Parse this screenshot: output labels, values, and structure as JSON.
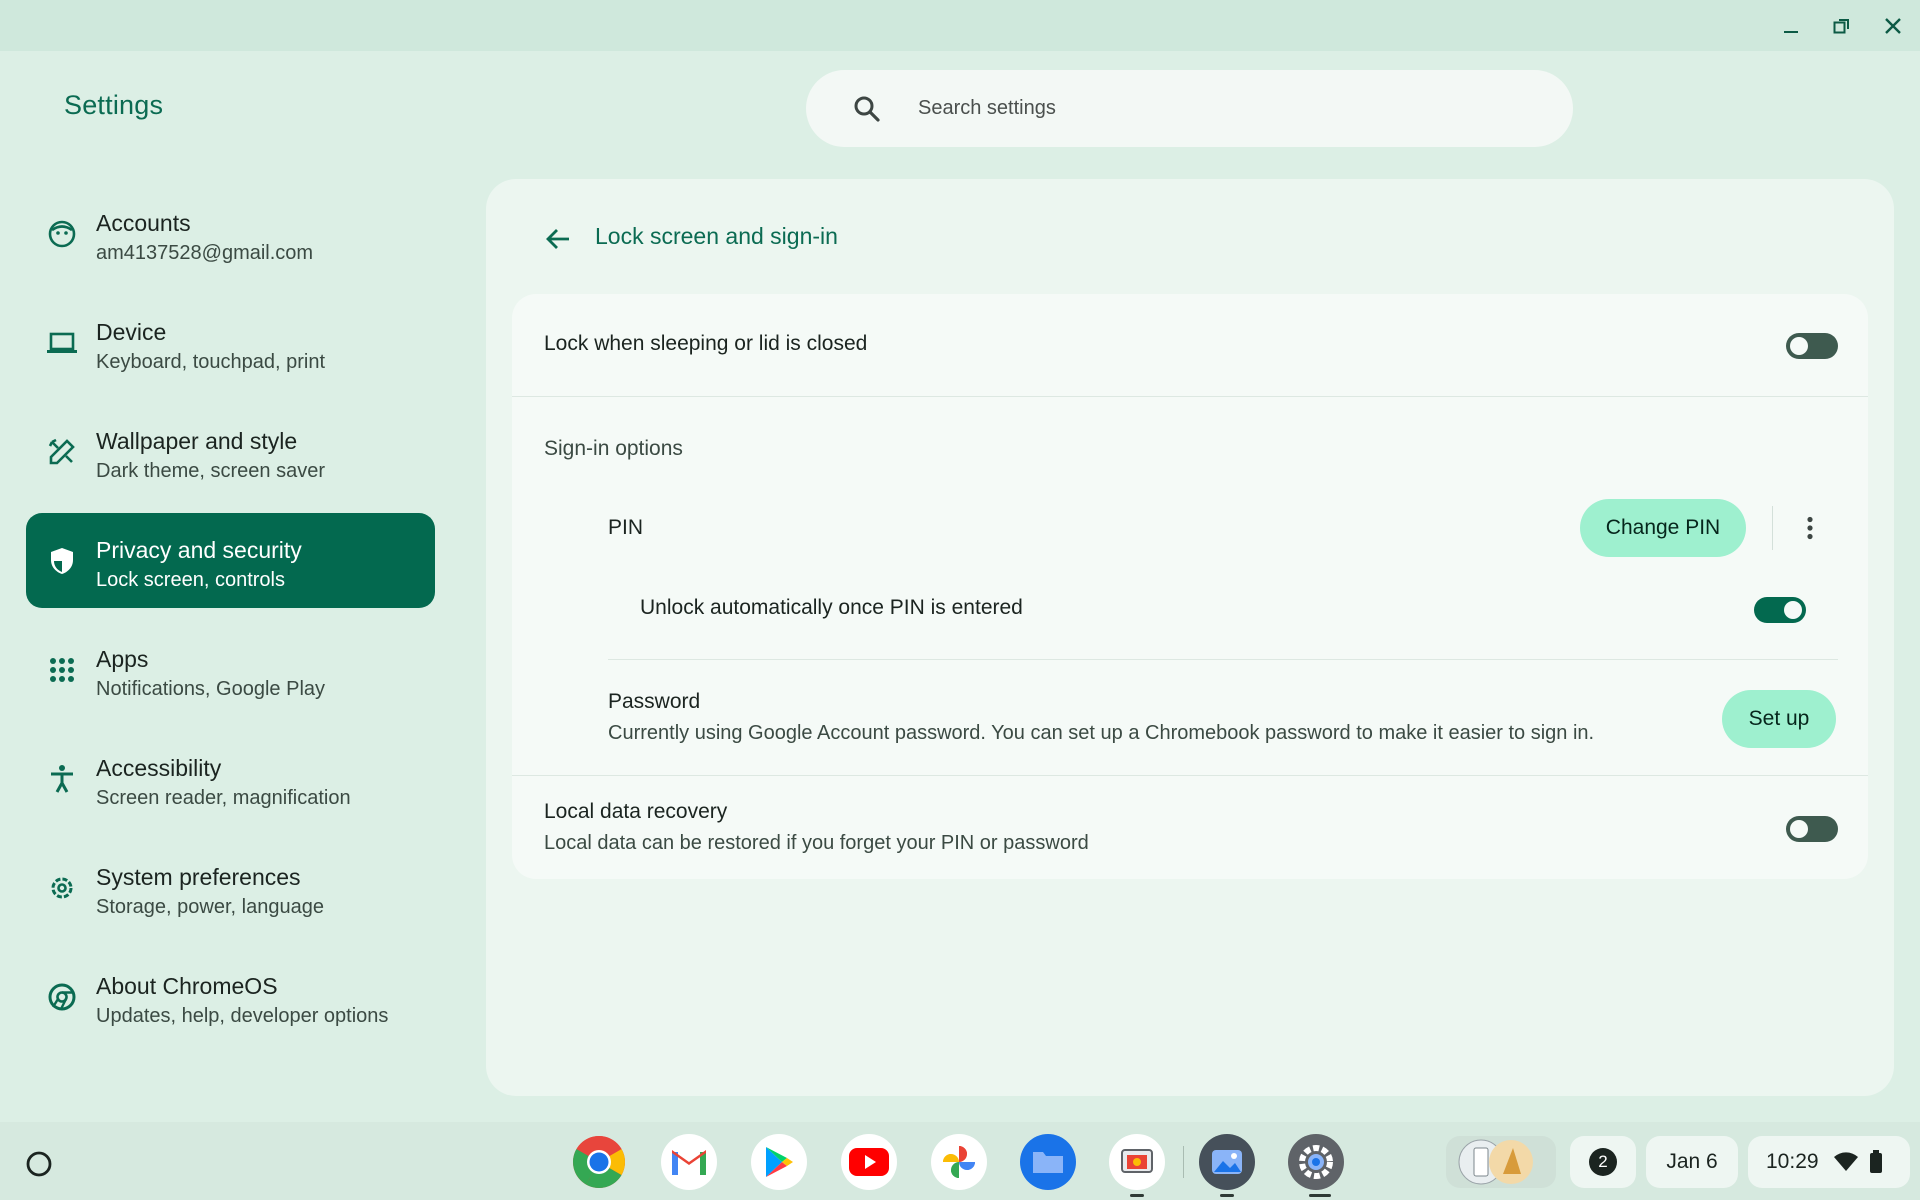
{
  "window": {
    "minimize_label": "Minimize",
    "maximize_label": "Restore",
    "close_label": "Close"
  },
  "app_title": "Settings",
  "search": {
    "placeholder": "Search settings"
  },
  "sidebar": {
    "items": [
      {
        "title": "Accounts",
        "subtitle": "am4137528@gmail.com",
        "icon": "account-face-icon"
      },
      {
        "title": "Device",
        "subtitle": "Keyboard, touchpad, print",
        "icon": "laptop-icon"
      },
      {
        "title": "Wallpaper and style",
        "subtitle": "Dark theme, screen saver",
        "icon": "wallpaper-pen-icon"
      },
      {
        "title": "Privacy and security",
        "subtitle": "Lock screen, controls",
        "icon": "shield-icon",
        "active": true
      },
      {
        "title": "Apps",
        "subtitle": "Notifications, Google Play",
        "icon": "apps-grid-icon"
      },
      {
        "title": "Accessibility",
        "subtitle": "Screen reader, magnification",
        "icon": "accessibility-icon"
      },
      {
        "title": "System preferences",
        "subtitle": "Storage, power, language",
        "icon": "gear-icon"
      },
      {
        "title": "About ChromeOS",
        "subtitle": "Updates, help, developer options",
        "icon": "chromeos-icon"
      }
    ]
  },
  "page": {
    "title": "Lock screen and sign-in",
    "lock_when_sleeping": {
      "label": "Lock when sleeping or lid is closed",
      "enabled": false
    },
    "signin_options_heading": "Sign-in options",
    "pin": {
      "label": "PIN",
      "button": "Change PIN"
    },
    "unlock_auto": {
      "label": "Unlock automatically once PIN is entered",
      "enabled": true
    },
    "password": {
      "label": "Password",
      "description": "Currently using Google Account password. You can set up a Chromebook password to make it easier to sign in.",
      "button": "Set up"
    },
    "local_recovery": {
      "label": "Local data recovery",
      "description": "Local data can be restored if you forget your PIN or password",
      "enabled": false
    }
  },
  "shelf": {
    "apps": [
      "chrome-icon",
      "gmail-icon",
      "play-store-icon",
      "youtube-icon",
      "photos-icon",
      "files-icon",
      "screenshot-app-icon",
      "gallery-icon",
      "settings-app-icon"
    ],
    "notification_count": "2",
    "date": "Jan 6",
    "time": "10:29"
  },
  "colors": {
    "accent": "#03694f",
    "background": "#dcefe5",
    "button": "#9ef0cf"
  }
}
